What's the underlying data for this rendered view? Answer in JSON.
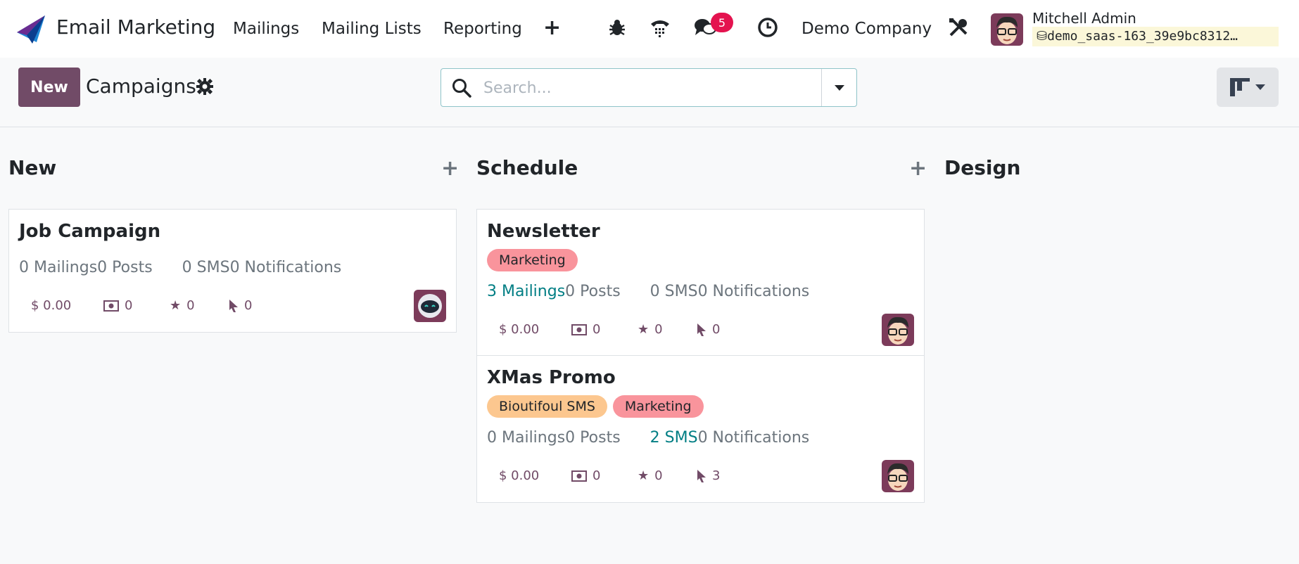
{
  "app": {
    "name": "Email Marketing"
  },
  "menu": [
    "Mailings",
    "Mailing Lists",
    "Reporting"
  ],
  "systray": {
    "messages_badge": "5",
    "company": "Demo Company",
    "user_name": "Mitchell Admin",
    "db_name": "demo_saas-163_39e9bc8312…"
  },
  "control": {
    "new_label": "New",
    "title": "Campaigns",
    "search_placeholder": "Search..."
  },
  "columns": [
    {
      "title": "New",
      "cards": [
        {
          "title": "Job Campaign",
          "tags": [],
          "mailings": "0 Mailings",
          "posts": "0 Posts",
          "sms": "0 SMS",
          "notifications": "0 Notifications",
          "revenue": "$ 0.00",
          "quotations": "0",
          "opportunities": "0",
          "clicks": "0",
          "assignee": "robot"
        }
      ]
    },
    {
      "title": "Schedule",
      "cards": [
        {
          "title": "Newsletter",
          "tags": [
            "Marketing"
          ],
          "mailings": "3 Mailings",
          "posts": "0 Posts",
          "sms": "0 SMS",
          "notifications": "0 Notifications",
          "revenue": "$ 0.00",
          "quotations": "0",
          "opportunities": "0",
          "clicks": "0",
          "assignee": "Mitchell Admin"
        },
        {
          "title": "XMas Promo",
          "tags": [
            "Bioutifoul SMS",
            "Marketing"
          ],
          "mailings": "0 Mailings",
          "posts": "0 Posts",
          "sms": "2 SMS",
          "notifications": "0 Notifications",
          "revenue": "$ 0.00",
          "quotations": "0",
          "opportunities": "0",
          "clicks": "3",
          "assignee": "Mitchell Admin"
        }
      ]
    },
    {
      "title": "Design",
      "cards": []
    }
  ],
  "colors": {
    "primary": "#714b67",
    "link": "#017e84",
    "tag_marketing": "#f9949c",
    "tag_sms": "#fcc78f",
    "badge": "#e4134f"
  }
}
